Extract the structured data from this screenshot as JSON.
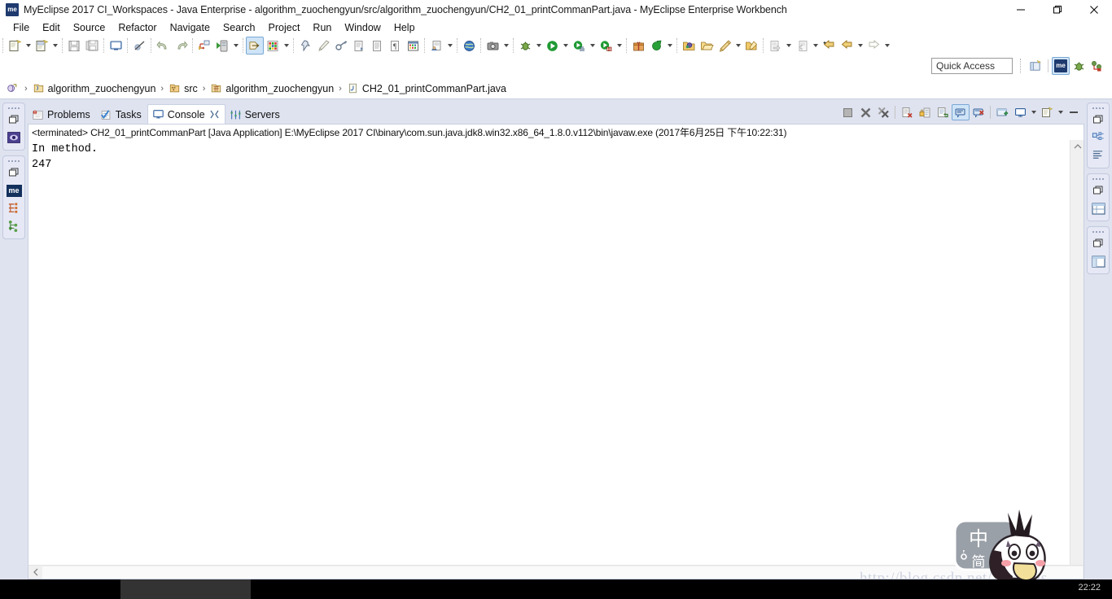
{
  "window": {
    "title": "MyEclipse 2017 CI_Workspaces - Java Enterprise - algorithm_zuochengyun/src/algorithm_zuochengyun/CH2_01_printCommanPart.java - MyEclipse Enterprise Workbench",
    "app_icon": "me",
    "controls": {
      "minimize": "minimize-icon",
      "maximize": "restore-icon",
      "close": "close-icon"
    }
  },
  "menubar": {
    "items": [
      {
        "label": "File"
      },
      {
        "label": "Edit"
      },
      {
        "label": "Source"
      },
      {
        "label": "Refactor"
      },
      {
        "label": "Navigate"
      },
      {
        "label": "Search"
      },
      {
        "label": "Project"
      },
      {
        "label": "Run"
      },
      {
        "label": "Window"
      },
      {
        "label": "Help"
      }
    ]
  },
  "toolbar": {
    "groups": [
      {
        "buttons": [
          {
            "name": "new-wizard-button",
            "icon": "new-file-icon",
            "dropdown": true,
            "selected": false
          },
          {
            "name": "new-java-class-button",
            "icon": "new-class-icon",
            "dropdown": true,
            "selected": false
          }
        ]
      },
      {
        "buttons": [
          {
            "name": "save-button",
            "icon": "save-icon",
            "dropdown": false,
            "selected": false
          },
          {
            "name": "save-all-button",
            "icon": "save-all-icon",
            "dropdown": false,
            "selected": false
          }
        ]
      },
      {
        "buttons": [
          {
            "name": "open-console-button",
            "icon": "console-monitor-icon",
            "dropdown": false,
            "selected": false
          }
        ]
      },
      {
        "buttons": [
          {
            "name": "skip-breakpoints-button",
            "icon": "skip-breakpoints-icon",
            "dropdown": false,
            "selected": false
          }
        ]
      },
      {
        "buttons": [
          {
            "name": "undo-button",
            "icon": "undo-arrow-icon",
            "dropdown": false,
            "selected": false
          },
          {
            "name": "redo-button",
            "icon": "redo-arrow-icon",
            "dropdown": false,
            "selected": false
          }
        ]
      },
      {
        "buttons": [
          {
            "name": "deploy-button",
            "icon": "deploy-icon",
            "dropdown": false,
            "selected": false
          },
          {
            "name": "run-server-button",
            "icon": "run-server-icon",
            "dropdown": true,
            "selected": false
          }
        ]
      },
      {
        "buttons": [
          {
            "name": "open-perspective-button",
            "icon": "open-perspective-icon",
            "dropdown": false,
            "selected": true
          },
          {
            "name": "myeclipse-apps-button",
            "icon": "color-grid-icon",
            "dropdown": true,
            "selected": false
          }
        ]
      },
      {
        "buttons": [
          {
            "name": "profile-button",
            "icon": "pin-icon",
            "dropdown": false,
            "selected": false
          },
          {
            "name": "clean-button",
            "icon": "brush-icon",
            "dropdown": false,
            "selected": false
          },
          {
            "name": "key-button",
            "icon": "key-icon",
            "dropdown": false,
            "selected": false
          },
          {
            "name": "new-xml-button",
            "icon": "xml-doc-icon",
            "dropdown": false,
            "selected": false
          },
          {
            "name": "new-doc-button",
            "icon": "plain-doc-icon",
            "dropdown": false,
            "selected": false
          },
          {
            "name": "new-text-button",
            "icon": "paragraph-icon",
            "dropdown": false,
            "selected": false
          },
          {
            "name": "matrix-button",
            "icon": "matrix-grid-icon",
            "dropdown": false,
            "selected": false
          }
        ]
      },
      {
        "buttons": [
          {
            "name": "preview-button",
            "icon": "preview-page-icon",
            "dropdown": true,
            "selected": false
          }
        ]
      },
      {
        "buttons": [
          {
            "name": "open-browser-button",
            "icon": "globe-icon",
            "dropdown": false,
            "selected": false
          }
        ]
      },
      {
        "buttons": [
          {
            "name": "snapshot-button",
            "icon": "camera-icon",
            "dropdown": true,
            "selected": false
          }
        ]
      },
      {
        "buttons": [
          {
            "name": "debug-button",
            "icon": "bug-icon",
            "dropdown": true,
            "selected": false
          },
          {
            "name": "run-button",
            "icon": "run-green-play-icon",
            "dropdown": true,
            "selected": false
          },
          {
            "name": "run-configurations-button",
            "icon": "run-config-icon",
            "dropdown": true,
            "selected": false
          },
          {
            "name": "run-with-coverage-button",
            "icon": "coverage-icon",
            "dropdown": true,
            "selected": false
          }
        ]
      },
      {
        "buttons": [
          {
            "name": "new-package-button",
            "icon": "package-gift-icon",
            "dropdown": false,
            "selected": false
          },
          {
            "name": "refresh-button",
            "icon": "refresh-green-icon",
            "dropdown": true,
            "selected": false
          }
        ]
      },
      {
        "buttons": [
          {
            "name": "search-button",
            "icon": "search-folder-icon",
            "dropdown": false,
            "selected": false
          },
          {
            "name": "open-type-button",
            "icon": "open-folder-icon",
            "dropdown": false,
            "selected": false
          },
          {
            "name": "open-task-button",
            "icon": "pencil-folder-icon",
            "dropdown": true,
            "selected": false
          },
          {
            "name": "last-edit-button",
            "icon": "folder-edit-icon",
            "dropdown": false,
            "selected": false
          }
        ]
      },
      {
        "buttons": [
          {
            "name": "next-annotation-button",
            "icon": "next-annotation-icon",
            "dropdown": true,
            "selected": false
          },
          {
            "name": "previous-annotation-button",
            "icon": "prev-annotation-icon",
            "dropdown": true,
            "selected": false
          },
          {
            "name": "back-to-last-edit-button",
            "icon": "yellow-back-star-icon",
            "dropdown": false,
            "selected": false
          },
          {
            "name": "back-button",
            "icon": "back-arrow-icon",
            "dropdown": true,
            "selected": false
          },
          {
            "name": "forward-button",
            "icon": "forward-arrow-icon",
            "dropdown": true,
            "selected": false
          }
        ]
      }
    ]
  },
  "quick_access": {
    "placeholder": "Quick Access",
    "value": "Quick Access",
    "perspective_buttons": [
      {
        "name": "open-perspective-button",
        "icon": "open-perspective-icon",
        "selected": false
      },
      {
        "name": "perspective-myeclipse-java-enterprise",
        "icon": "me-badge-icon",
        "selected": true
      },
      {
        "name": "perspective-debug",
        "icon": "bug-icon",
        "selected": false
      },
      {
        "name": "perspective-team-synchronizing",
        "icon": "sync-icon",
        "selected": false
      }
    ]
  },
  "breadcrumb": {
    "root_icon": "workspace-icon",
    "separator": "›",
    "segments": [
      {
        "icon": "java-project-icon",
        "label": "algorithm_zuochengyun"
      },
      {
        "icon": "source-folder-icon",
        "label": "src"
      },
      {
        "icon": "package-icon",
        "label": "algorithm_zuochengyun"
      },
      {
        "icon": "java-file-icon",
        "label": "CH2_01_printCommanPart.java"
      }
    ]
  },
  "left_sidebar": {
    "groups": [
      {
        "items": [
          {
            "name": "fastview-restore-icon",
            "icon": "restore-window-icon"
          },
          {
            "name": "fastview-package-explorer",
            "icon": "purple-eye-icon"
          }
        ]
      },
      {
        "items": [
          {
            "name": "fastview-restore-icon-2",
            "icon": "restore-window-icon"
          },
          {
            "name": "fastview-myeclipse",
            "icon": "me-badge-icon"
          },
          {
            "name": "fastview-db-browser",
            "icon": "db-browser-icon"
          },
          {
            "name": "fastview-outline",
            "icon": "hierarchy-green-icon"
          }
        ]
      }
    ]
  },
  "right_sidebar": {
    "groups": [
      {
        "items": [
          {
            "name": "fastview-restore-icon-3",
            "icon": "restore-window-icon"
          },
          {
            "name": "fastview-outline-view",
            "icon": "outline-tree-icon"
          },
          {
            "name": "fastview-task-list",
            "icon": "task-list-icon"
          }
        ]
      },
      {
        "items": [
          {
            "name": "fastview-restore-icon-4",
            "icon": "restore-window-icon"
          },
          {
            "name": "fastview-properties",
            "icon": "table-view-icon"
          }
        ]
      },
      {
        "items": [
          {
            "name": "fastview-restore-icon-5",
            "icon": "restore-window-icon"
          },
          {
            "name": "fastview-servers-view",
            "icon": "split-view-icon"
          }
        ]
      }
    ]
  },
  "view_stack": {
    "tabs": [
      {
        "name": "tab-problems",
        "label": "Problems",
        "icon": "problems-icon",
        "active": false,
        "closable": false
      },
      {
        "name": "tab-tasks",
        "label": "Tasks",
        "icon": "tasks-icon",
        "active": false,
        "closable": false
      },
      {
        "name": "tab-console",
        "label": "Console",
        "icon": "console-icon",
        "active": true,
        "closable": true
      },
      {
        "name": "tab-servers",
        "label": "Servers",
        "icon": "servers-icon",
        "active": false,
        "closable": false
      }
    ],
    "toolbar": [
      {
        "name": "terminate-button",
        "icon": "terminate-stop-icon",
        "selected": false,
        "dropdown": false
      },
      {
        "name": "remove-launch-button",
        "icon": "remove-launch-x-icon",
        "selected": false,
        "dropdown": false
      },
      {
        "name": "remove-all-terminated-button",
        "icon": "remove-all-launches-icon",
        "selected": false,
        "dropdown": false
      },
      {
        "name": "separator-1",
        "icon": "separator",
        "selected": false,
        "dropdown": false
      },
      {
        "name": "clear-console-button",
        "icon": "clear-console-icon",
        "selected": false,
        "dropdown": false
      },
      {
        "name": "scroll-lock-button",
        "icon": "scroll-lock-icon",
        "selected": false,
        "dropdown": false
      },
      {
        "name": "word-wrap-button",
        "icon": "word-wrap-icon",
        "selected": false,
        "dropdown": false
      },
      {
        "name": "show-console-on-output-button",
        "icon": "show-console-stdout-icon",
        "selected": true,
        "dropdown": false
      },
      {
        "name": "show-console-on-error-button",
        "icon": "show-console-stderr-icon",
        "selected": false,
        "dropdown": false
      },
      {
        "name": "separator-2",
        "icon": "separator",
        "selected": false,
        "dropdown": false
      },
      {
        "name": "pin-console-button",
        "icon": "pin-console-icon",
        "selected": false,
        "dropdown": false
      },
      {
        "name": "display-selected-console-button",
        "icon": "display-console-icon",
        "selected": false,
        "dropdown": true
      },
      {
        "name": "open-console-button",
        "icon": "new-console-icon",
        "selected": false,
        "dropdown": true
      },
      {
        "name": "minimize-view-button",
        "icon": "minimize-view-icon",
        "selected": false,
        "dropdown": false
      }
    ]
  },
  "console": {
    "header": "<terminated> CH2_01_printCommanPart [Java Application] E:\\MyEclipse 2017 CI\\binary\\com.sun.java.jdk8.win32.x86_64_1.8.0.v112\\bin\\javaw.exe (2017年6月25日 下午10:22:31)",
    "output": "In method.\n247",
    "output_lines": [
      "In method.",
      "247"
    ],
    "scrollbars": {
      "vertical_arrow": "chevron-up-icon",
      "horizontal_arrow": "chevron-left-icon"
    }
  },
  "watermark": {
    "url": "http://blog.csdn.net/TTTTris",
    "ime": {
      "mode_char": "中",
      "script_char": "简"
    }
  },
  "taskbar": {
    "clock": "22:22"
  },
  "colors": {
    "accent_selected": "#cfe4f7",
    "accent_border": "#7aa8d4",
    "panel_bg": "#dfe3f0",
    "console_bg": "#ffffff",
    "text": "#111111"
  }
}
